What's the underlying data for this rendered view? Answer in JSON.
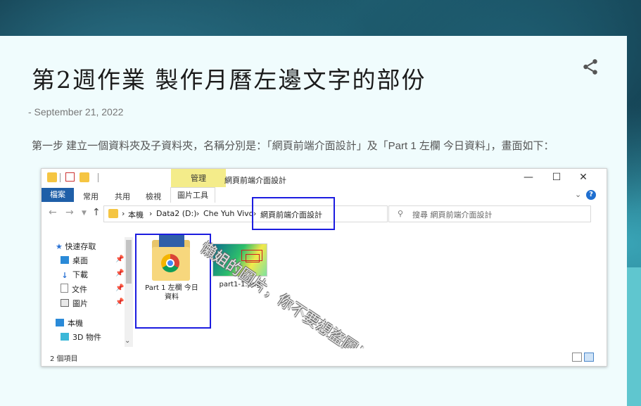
{
  "post": {
    "title": "第2週作業 製作月曆左邊文字的部份",
    "date": "- September 21, 2022",
    "paragraph": "第一步 建立一個資料夾及子資料夾，名稱分別是：「網頁前端介面設計」及「Part 1 左欄 今日資料」，畫面如下："
  },
  "explorer": {
    "window_title": "網頁前端介面設計",
    "manage_tab": "管理",
    "ribbon": {
      "file": "檔案",
      "tabs": [
        "常用",
        "共用",
        "檢視"
      ],
      "active_tab": "圖片工具"
    },
    "address": {
      "crumbs": [
        "本機",
        "Data2 (D:)",
        "Che Yuh Vivo",
        "網頁前端介面設計"
      ]
    },
    "search_placeholder": "搜尋 網頁前端介面設計",
    "nav": {
      "quick_access": "快速存取",
      "items": [
        "桌面",
        "下載",
        "文件",
        "圖片"
      ],
      "this_pc": "本機",
      "objects3d": "3D 物件"
    },
    "files": [
      {
        "name": "Part 1 左欄 今日資料",
        "line1": "Part 1 左欄 今日",
        "line2": "資料"
      },
      {
        "name": "part1-1.png"
      }
    ],
    "status": "2 個項目",
    "watermark": "懶姐的圖片，你不要想盜圖！"
  },
  "colors": {
    "card_bg": "#f0fcfd",
    "highlight": "#1c1ce0",
    "file_tab": "#1f5fa8",
    "manage_tab": "#f4ec8a"
  }
}
